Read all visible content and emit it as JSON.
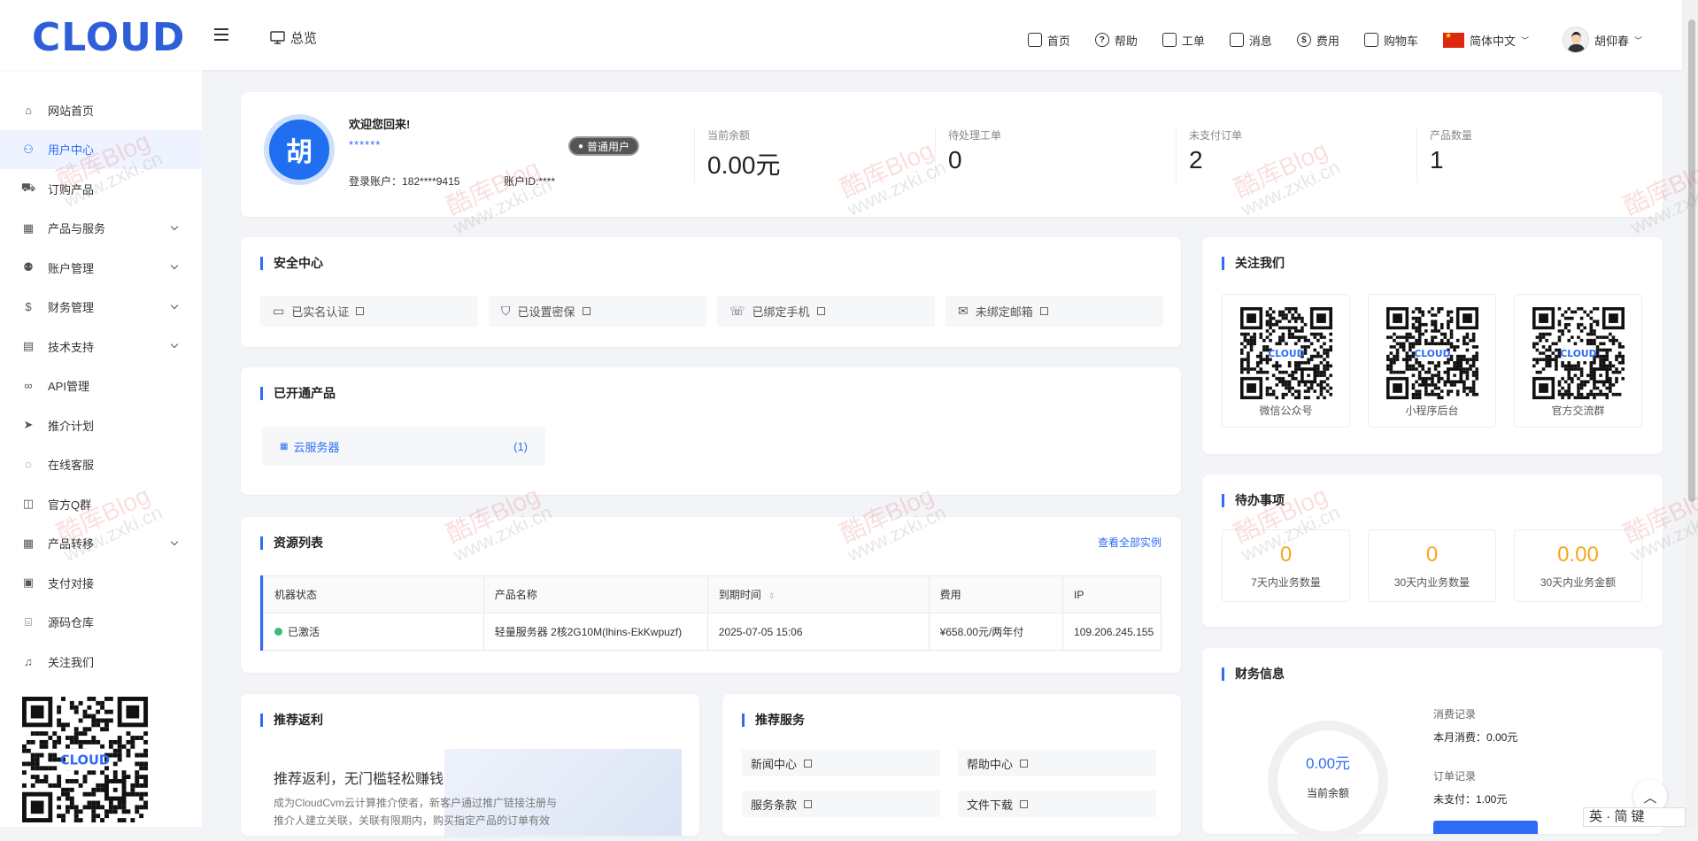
{
  "brand": {
    "logo_text": "CLOUD",
    "accent": "#2e6cf6"
  },
  "header": {
    "overview_label": "总览",
    "nav": [
      {
        "label": "首页",
        "icon": "monitor-icon"
      },
      {
        "label": "帮助",
        "icon": "help-circle-icon"
      },
      {
        "label": "工单",
        "icon": "ticket-icon"
      },
      {
        "label": "消息",
        "icon": "bell-icon"
      },
      {
        "label": "费用",
        "icon": "dollar-circle-icon"
      },
      {
        "label": "购物车",
        "icon": "cart-icon"
      }
    ],
    "language": "简体中文",
    "username": "胡仰春"
  },
  "sidebar": {
    "items": [
      {
        "label": "网站首页",
        "icon": "home-icon",
        "expandable": false
      },
      {
        "label": "用户中心",
        "icon": "user-icon",
        "expandable": false,
        "active": true
      },
      {
        "label": "订购产品",
        "icon": "cart-icon",
        "expandable": false
      },
      {
        "label": "产品与服务",
        "icon": "grid-icon",
        "expandable": true
      },
      {
        "label": "账户管理",
        "icon": "users-icon",
        "expandable": true
      },
      {
        "label": "财务管理",
        "icon": "dollar-circle-icon",
        "expandable": true
      },
      {
        "label": "技术支持",
        "icon": "document-icon",
        "expandable": true
      },
      {
        "label": "API管理",
        "icon": "api-icon",
        "expandable": false
      },
      {
        "label": "推介计划",
        "icon": "send-icon",
        "expandable": false
      },
      {
        "label": "在线客服",
        "icon": "chat-icon",
        "expandable": false
      },
      {
        "label": "官方Q群",
        "icon": "group-icon",
        "expandable": false
      },
      {
        "label": "产品转移",
        "icon": "grid-icon",
        "expandable": true
      },
      {
        "label": "支付对接",
        "icon": "wallet-icon",
        "expandable": false
      },
      {
        "label": "源码仓库",
        "icon": "code-icon",
        "expandable": false
      },
      {
        "label": "关注我们",
        "icon": "bell-icon",
        "expandable": false
      }
    ]
  },
  "profile": {
    "avatar_char": "胡",
    "welcome": "欢迎您回来!",
    "masked_name": "******",
    "badge": "普通用户",
    "login_account_label": "登录账户：",
    "login_account": "182****9415",
    "account_id_label": "账户ID:",
    "account_id": "****"
  },
  "stats": [
    {
      "label": "当前余额",
      "value": "0.00元"
    },
    {
      "label": "待处理工单",
      "value": "0"
    },
    {
      "label": "未支付订单",
      "value": "2"
    },
    {
      "label": "产品数量",
      "value": "1"
    }
  ],
  "security": {
    "title": "安全中心",
    "items": [
      {
        "label": "已实名认证",
        "icon": "id-card-icon"
      },
      {
        "label": "已设置密保",
        "icon": "shield-icon"
      },
      {
        "label": "已绑定手机",
        "icon": "phone-icon"
      },
      {
        "label": "未绑定邮箱",
        "icon": "mail-icon"
      }
    ]
  },
  "follow": {
    "title": "关注我们",
    "codes": [
      {
        "caption": "微信公众号"
      },
      {
        "caption": "小程序后台"
      },
      {
        "caption": "官方交流群"
      }
    ],
    "qr_text": "CLOUD"
  },
  "products": {
    "title": "已开通产品",
    "items": [
      {
        "label": "云服务器",
        "count": "(1)"
      }
    ]
  },
  "todo": {
    "title": "待办事项",
    "items": [
      {
        "value": "0",
        "label": "7天内业务数量"
      },
      {
        "value": "0",
        "label": "30天内业务数量"
      },
      {
        "value": "0.00",
        "label": "30天内业务金额"
      }
    ]
  },
  "resources": {
    "title": "资源列表",
    "view_all": "查看全部实例",
    "columns": [
      "机器状态",
      "产品名称",
      "到期时间",
      "费用",
      "IP"
    ],
    "rows": [
      {
        "status": "已激活",
        "status_color": "#3cba7a",
        "name": "轻量服务器 2核2G10M(lhins-EkKwpuzf)",
        "expire": "2025-07-05 15:06",
        "fee": "¥658.00元/两年付",
        "ip": "109.206.245.155"
      }
    ]
  },
  "referral": {
    "title": "推荐返利",
    "headline": "推荐返利，无门槛轻松赚钱",
    "desc1": "成为CloudCvm云计算推介使者，新客户通过推广链接注册与",
    "desc2": "推介人建立关联，关联有限期内，购买指定产品的订单有效"
  },
  "services": {
    "title": "推荐服务",
    "items": [
      "新闻中心",
      "帮助中心",
      "服务条款",
      "文件下载"
    ]
  },
  "finance": {
    "title": "财务信息",
    "balance": "0.00元",
    "balance_label": "当前余额",
    "consume_title": "消费记录",
    "consume_text": "本月消费：0.00元",
    "order_title": "订单记录",
    "order_text": "未支付：1.00元"
  },
  "watermark": {
    "text_cn": "酷库Blog",
    "text_url": "www.zxki.cn"
  },
  "ime": {
    "text": "英 · 简 键"
  }
}
